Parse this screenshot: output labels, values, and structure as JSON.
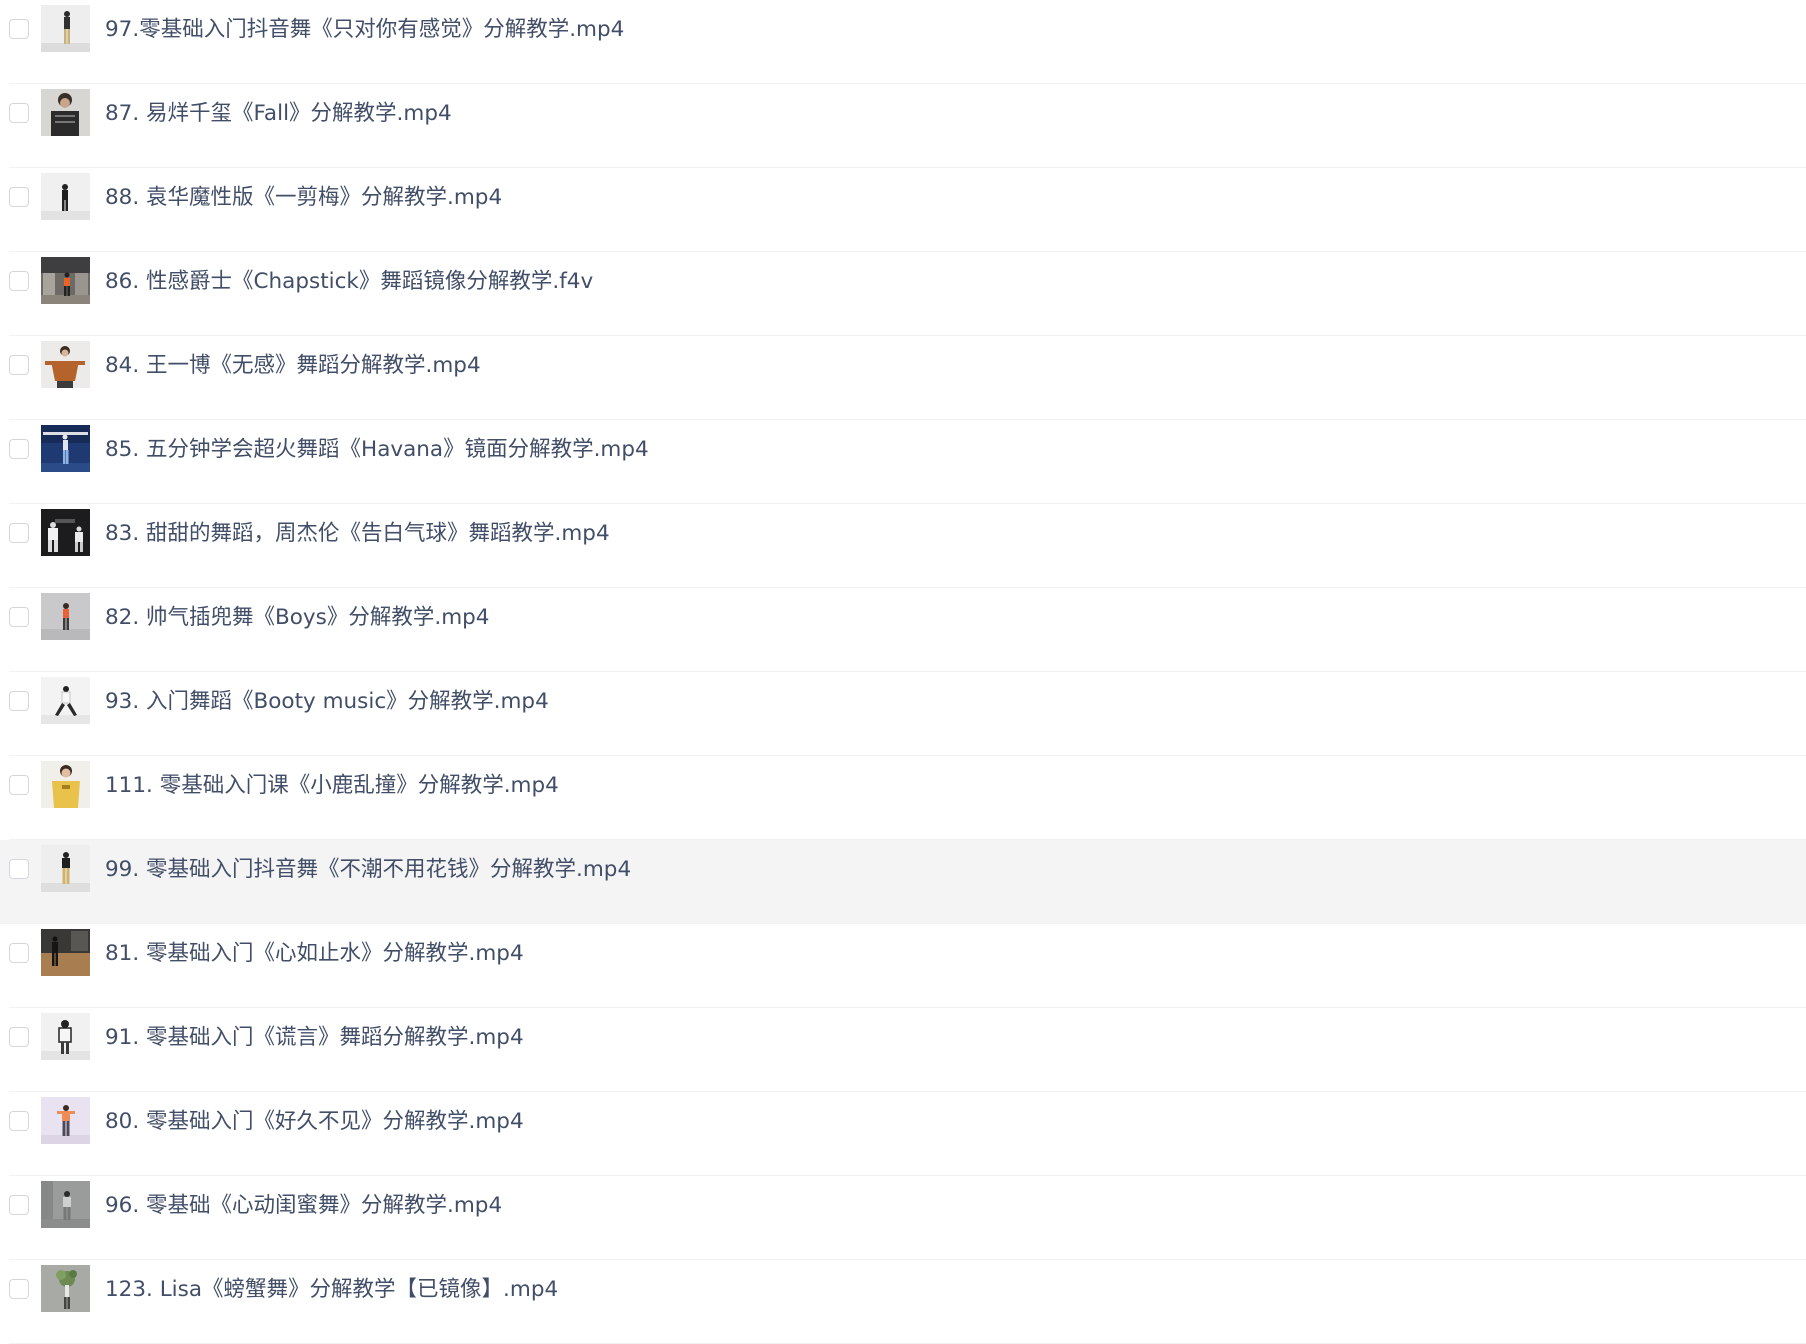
{
  "file_list": {
    "items": [
      {
        "name": "97.零基础入门抖音舞《只对你有感觉》分解教学.mp4",
        "thumb": "dancer-white-bg"
      },
      {
        "name": "87. 易烊千玺《Fall》分解教学.mp4",
        "thumb": "dancer-closeup"
      },
      {
        "name": "88. 袁华魔性版《一剪梅》分解教学.mp4",
        "thumb": "dancer-white-bg"
      },
      {
        "name": "86. 性感爵士《Chapstick》舞蹈镜像分解教学.f4v",
        "thumb": "dancer-studio"
      },
      {
        "name": "84. 王一博《无感》舞蹈分解教学.mp4",
        "thumb": "dancer-orange"
      },
      {
        "name": "85. 五分钟学会超火舞蹈《Havana》镜面分解教学.mp4",
        "thumb": "dancer-blue-stage"
      },
      {
        "name": "83. 甜甜的舞蹈，周杰伦《告白气球》舞蹈教学.mp4",
        "thumb": "dancers-dark"
      },
      {
        "name": "82. 帅气插兜舞《Boys》分解教学.mp4",
        "thumb": "dancer-grey-bg"
      },
      {
        "name": "93. 入门舞蹈《Booty music》分解教学.mp4",
        "thumb": "dancer-white-bg"
      },
      {
        "name": "111. 零基础入门课《小鹿乱撞》分解教学.mp4",
        "thumb": "dancer-yellow"
      },
      {
        "name": "99. 零基础入门抖音舞《不潮不用花钱》分解教学.mp4",
        "thumb": "dancer-white-bg"
      },
      {
        "name": "81. 零基础入门《心如止水》分解教学.mp4",
        "thumb": "dancer-wood"
      },
      {
        "name": "91. 零基础入门《谎言》舞蹈分解教学.mp4",
        "thumb": "dancer-white-bg"
      },
      {
        "name": "80. 零基础入门《好久不见》分解教学.mp4",
        "thumb": "dancer-lavender"
      },
      {
        "name": "96. 零基础《心动闺蜜舞》分解教学.mp4",
        "thumb": "dancer-grey-bg"
      },
      {
        "name": "123. Lisa《螃蟹舞》分解教学【已镜像】.mp4",
        "thumb": "dancer-plant"
      }
    ],
    "hovered_index": 10
  },
  "colors": {
    "text": "#424e67",
    "divider": "#f1f2f4",
    "hover_bg": "#f4f4f5",
    "checkbox_border": "#d4d7dd"
  }
}
